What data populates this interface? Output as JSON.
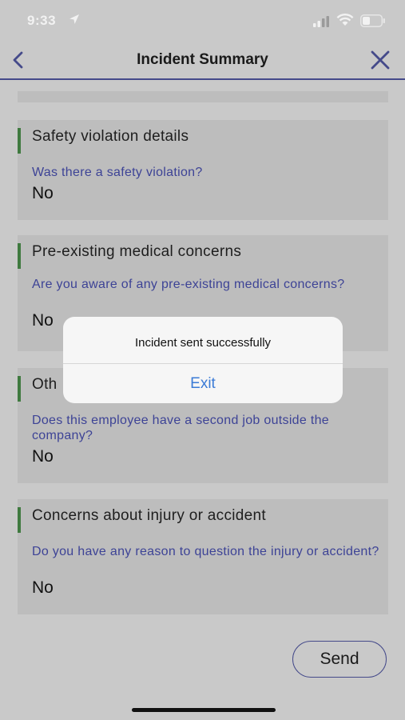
{
  "status_bar": {
    "time": "9:33"
  },
  "nav": {
    "title": "Incident Summary"
  },
  "cards": [
    {
      "title": "Safety violation details",
      "question": "Was there a safety violation?",
      "answer": "No"
    },
    {
      "title": "Pre-existing medical concerns",
      "question": "Are you aware of any pre-existing medical concerns?",
      "answer": "No"
    },
    {
      "title": "Oth",
      "question": "Does this employee have a second job outside the company?",
      "answer": "No"
    },
    {
      "title": "Concerns about injury or accident",
      "question": "Do you have any reason to question the injury or accident?",
      "answer": "No"
    }
  ],
  "send_label": "Send",
  "dialog": {
    "message": "Incident sent successfully",
    "exit_label": "Exit"
  },
  "colors": {
    "accent_green": "#3f7a3f",
    "question_blue": "#3d4396",
    "dialog_link": "#3b7bd6"
  }
}
